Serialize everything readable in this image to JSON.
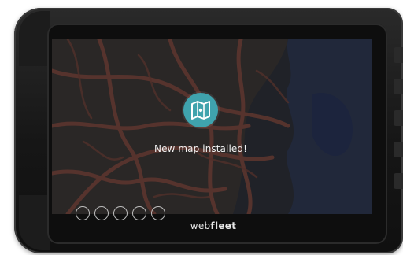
{
  "screen": {
    "notification": {
      "icon": "folded-map-icon",
      "message": "New map installed!"
    },
    "page_indicator": {
      "count": 5
    }
  },
  "device": {
    "brand_prefix": "web",
    "brand_suffix": "fleet"
  },
  "colors": {
    "accent": "#3fa3ad",
    "roads": "#8a4a3c",
    "water": "#2f3a52",
    "land": "#3a3a3a"
  }
}
